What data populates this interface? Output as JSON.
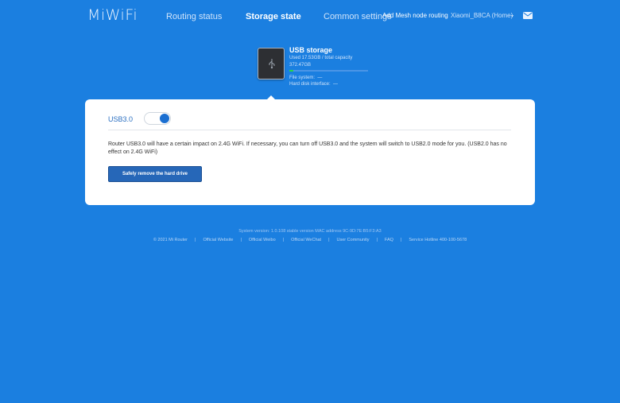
{
  "header": {
    "logo": "MiWiFi",
    "nav": {
      "routing_status": "Routing status",
      "storage_state": "Storage state",
      "common_settings": "Common settings"
    },
    "mesh_link": "Add Mesh node routing",
    "router_name": "Xiaomi_B8CA (Home)",
    "icons": {
      "dropdown": "chevron-down-icon",
      "mail": "mail-icon"
    }
  },
  "usb": {
    "title": "USB storage",
    "used": "Used 17.53GB / total capacity",
    "total": "372.47GB",
    "usage_fraction": 0.047,
    "file_system": "File system:  —",
    "hard_disk_interface": "Hard disk interface:  —"
  },
  "panel": {
    "usb3_label": "USB3.0",
    "usb3_enabled": true,
    "description": "Router USB3.0 will have a certain impact on 2.4G WiFi. If necessary, you can turn off USB3.0 and the system will switch to USB2.0 mode for you. (USB2.0 has no effect on 2.4G WiFi)",
    "remove_button": "Safely remove the hard drive"
  },
  "footer": {
    "version": "System version: 1.0.108 stable version MAC address 9C-9D:7E:B5:F3:A3",
    "links": [
      "© 2021 Mi Router",
      "Official Website",
      "Official Weibo",
      "Official WeChat",
      "User Community",
      "FAQ",
      "Service Hotline 400-100-5678"
    ]
  },
  "colors": {
    "background": "#1b7fe0",
    "button": "#2667b8",
    "toggle_on": "#1b6fd1",
    "usage_bar": "#29d64a"
  }
}
